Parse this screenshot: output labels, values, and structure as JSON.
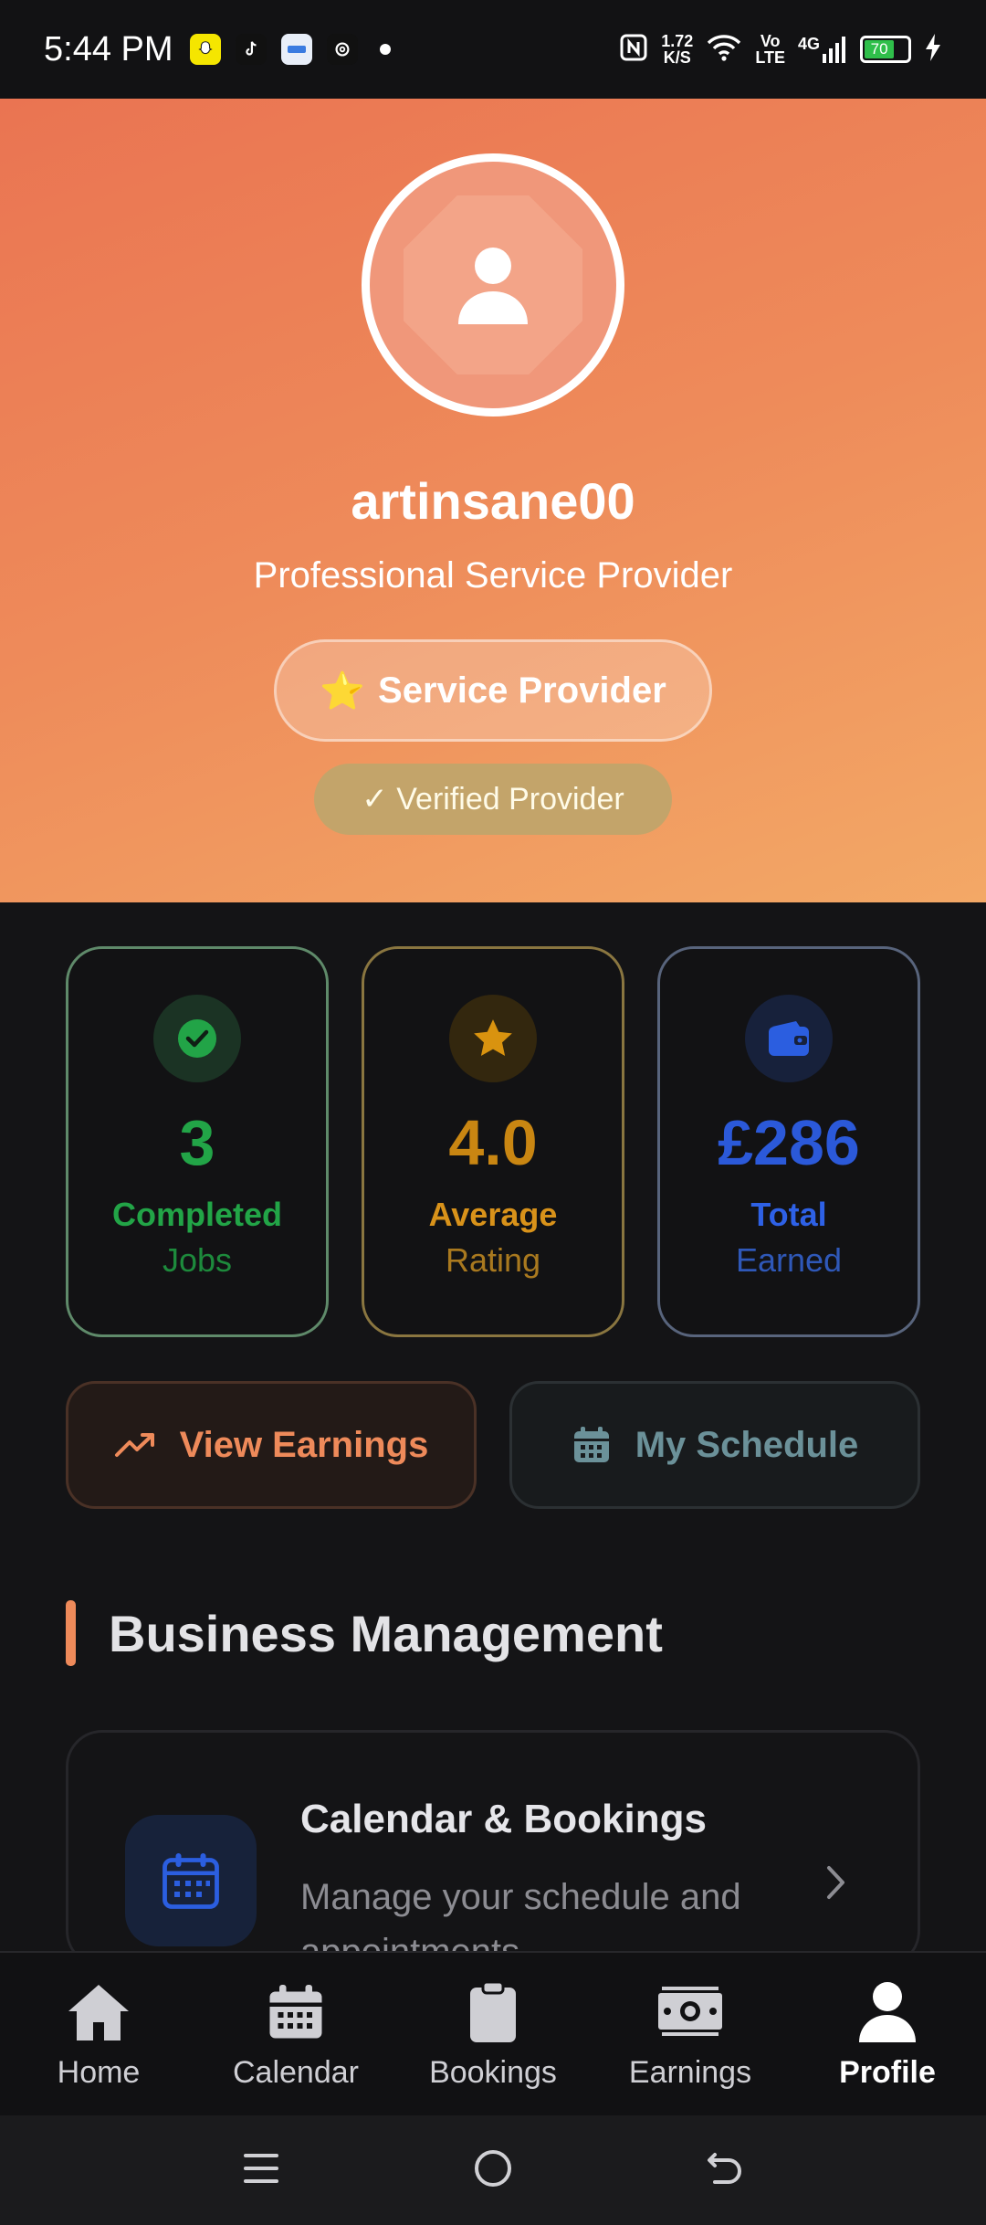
{
  "status_bar": {
    "time": "5:44 PM",
    "network_speed_value": "1.72",
    "network_speed_unit": "K/S",
    "volte_top": "Vo",
    "volte_bottom": "LTE",
    "network_type": "4G",
    "battery": "70"
  },
  "profile": {
    "username": "artinsane00",
    "subtitle": "Professional Service Provider",
    "role_badge": "Service Provider",
    "role_emoji": "⭐",
    "verified_badge": "✓ Verified Provider"
  },
  "stats": [
    {
      "value": "3",
      "label1": "Completed",
      "label2": "Jobs",
      "color": "#22a447"
    },
    {
      "value": "4.0",
      "label1": "Average",
      "label2": "Rating",
      "color": "#c98612"
    },
    {
      "value": "£286",
      "label1": "Total",
      "label2": "Earned",
      "color": "#2b59d9"
    }
  ],
  "actions": {
    "view_earnings": "View Earnings",
    "my_schedule": "My Schedule"
  },
  "section": {
    "title": "Business Management",
    "items": [
      {
        "title": "Calendar & Bookings",
        "description": "Manage your schedule and appointments"
      }
    ]
  },
  "bottom_nav": [
    {
      "label": "Home",
      "icon": "home-icon"
    },
    {
      "label": "Calendar",
      "icon": "calendar-icon"
    },
    {
      "label": "Bookings",
      "icon": "clipboard-icon"
    },
    {
      "label": "Earnings",
      "icon": "money-icon"
    },
    {
      "label": "Profile",
      "icon": "user-icon",
      "active": true
    }
  ],
  "colors": {
    "accent": "#ee8a5a",
    "header_gradient_start": "#ea7452",
    "header_gradient_end": "#f3a866",
    "background": "#141416"
  }
}
